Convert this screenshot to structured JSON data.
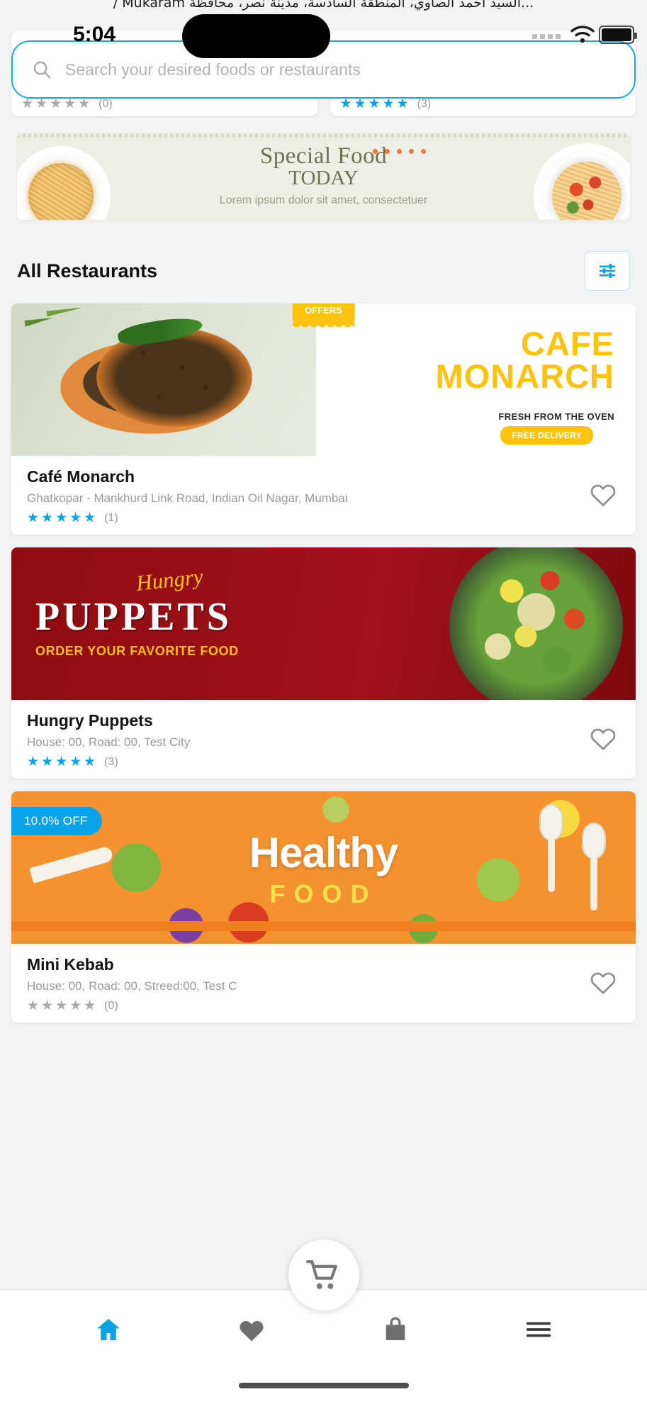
{
  "status_bar": {
    "time": "5:04",
    "wifi_icon": "wifi-icon",
    "battery_icon": "battery-icon",
    "signal_dots_icon": "signal-dots-icon"
  },
  "address_bar": {
    "text": "...السيد أحمد الصاوي، المنطقة السادسة، مدينة نصر، محافظة Mukaram / "
  },
  "search": {
    "placeholder": "Search your desired foods or restaurants",
    "icon": "search-icon"
  },
  "top_partial_cards": [
    {
      "stars": 5,
      "filled": 0,
      "count": "(0)"
    },
    {
      "stars": 5,
      "filled": 5,
      "count": "(3)"
    }
  ],
  "promo_banner": {
    "title": "Special Food",
    "subtitle": "TODAY",
    "lorem": "Lorem ipsum dolor sit amet, consectetuer",
    "dots": 5
  },
  "section": {
    "title": "All Restaurants",
    "filter_icon": "filter-sliders-icon",
    "filter_color": "#0aa3e8"
  },
  "restaurants": [
    {
      "name": "Café Monarch",
      "address": "Ghatkopar - Mankhurd Link Road, Indian Oil Nagar, Mumbai",
      "rating_filled": 5,
      "rating_count": "(1)",
      "favorite_icon": "heart-outline-icon",
      "banner": {
        "kind": "monarch",
        "brand_line1": "CAFE",
        "brand_line2": "MONARCH",
        "tagline": "FRESH FROM THE OVEN",
        "pill": "FREE DELIVERY",
        "badge": "OFFERS",
        "brand_color": "#ffc20e"
      }
    },
    {
      "name": "Hungry Puppets",
      "address": "House: 00, Road: 00, Test City",
      "rating_filled": 5,
      "rating_count": "(3)",
      "favorite_icon": "heart-outline-icon",
      "banner": {
        "kind": "puppets",
        "script": "Hungry",
        "main": "PUPPETS",
        "tagline": "ORDER YOUR FAVORITE FOOD",
        "brand_color": "#8e0c11"
      }
    },
    {
      "name": "Mini Kebab",
      "address": "House: 00, Road: 00, Streed:00, Test C",
      "rating_filled": 0,
      "rating_count": "(0)",
      "favorite_icon": "heart-outline-icon",
      "banner": {
        "kind": "healthy",
        "title": "Healthy",
        "subtitle": "FOOD",
        "discount": "10.0% OFF",
        "discount_color": "#0aa3e8",
        "brand_color": "#f4922f"
      }
    }
  ],
  "bottom_nav": {
    "cart_icon": "shopping-cart-icon",
    "items": [
      {
        "icon": "home-icon",
        "active": true
      },
      {
        "icon": "heart-icon",
        "active": false
      },
      {
        "icon": "bag-icon",
        "active": false
      },
      {
        "icon": "menu-icon",
        "active": false
      }
    ],
    "active_color": "#0aa3e8",
    "inactive_color": "#6f6f6f"
  }
}
